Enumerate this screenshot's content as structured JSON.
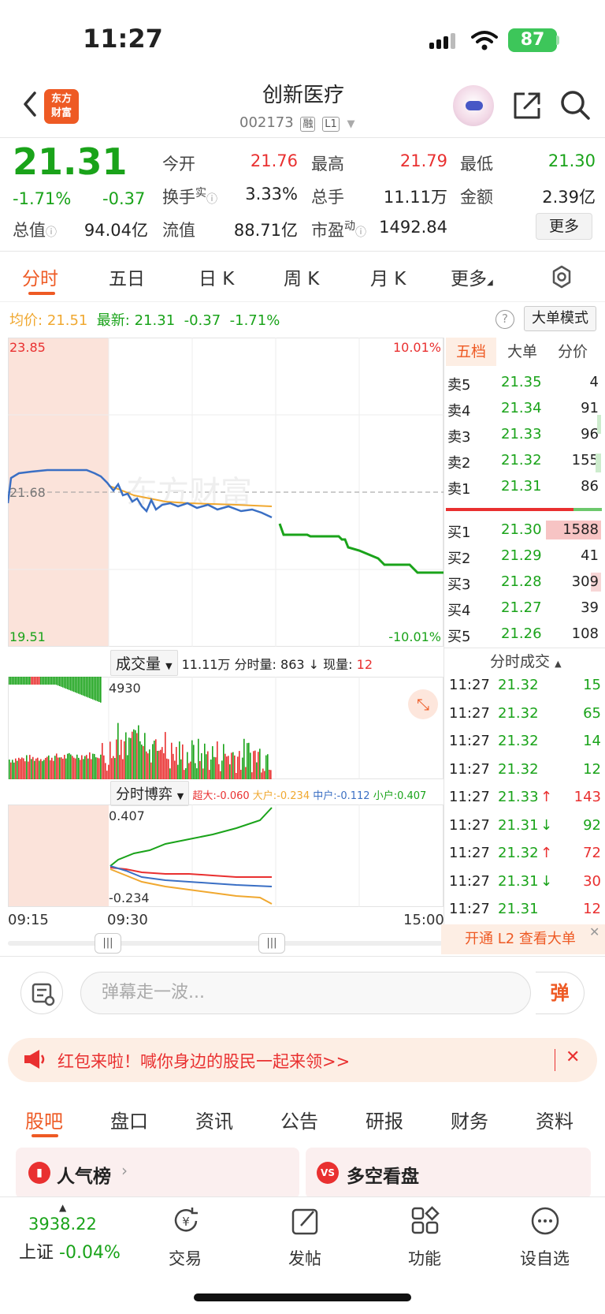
{
  "status": {
    "time": "11:27",
    "battery": "87"
  },
  "header": {
    "name": "创新医疗",
    "code": "002173",
    "tag_margin": "融",
    "tag_level": "L1",
    "logo_line1": "东方",
    "logo_line2": "财富"
  },
  "quote": {
    "price": "21.31",
    "change_pct": "-1.71%",
    "change": "-0.37",
    "open_label": "今开",
    "open": "21.76",
    "high_label": "最高",
    "high": "21.79",
    "low_label": "最低",
    "low": "21.30",
    "turnover_label": "换手",
    "turnover_sup": "实",
    "turnover": "3.33%",
    "volume_label": "总手",
    "volume": "11.11万",
    "amount_label": "金额",
    "amount": "2.39亿",
    "mktcap_label": "总值",
    "mktcap": "94.04亿",
    "float_label": "流值",
    "float_cap": "88.71亿",
    "pe_label": "市盈",
    "pe_sup": "动",
    "pe": "1492.84",
    "more_button": "更多"
  },
  "period_tabs": [
    "分时",
    "五日",
    "日 K",
    "周 K",
    "月 K",
    "更多"
  ],
  "info_line": {
    "avg_label": "均价:",
    "avg": "21.51",
    "latest_label": "最新:",
    "latest": "21.31",
    "chg": "-0.37",
    "pct": "-1.71%"
  },
  "mode_button": "大单模式",
  "chart_labels": {
    "ymax": "23.85",
    "ymin": "19.51",
    "pre_close": "21.68",
    "pct_max": "10.01%",
    "pct_min": "-10.01%",
    "watermark": "东方财富"
  },
  "orderbook": {
    "tabs": [
      "五档",
      "大单",
      "分价"
    ],
    "asks": [
      {
        "label": "卖5",
        "price": "21.35",
        "vol": "4"
      },
      {
        "label": "卖4",
        "price": "21.34",
        "vol": "91"
      },
      {
        "label": "卖3",
        "price": "21.33",
        "vol": "96"
      },
      {
        "label": "卖2",
        "price": "21.32",
        "vol": "155"
      },
      {
        "label": "卖1",
        "price": "21.31",
        "vol": "86"
      }
    ],
    "bids": [
      {
        "label": "买1",
        "price": "21.30",
        "vol": "1588"
      },
      {
        "label": "买2",
        "price": "21.29",
        "vol": "41"
      },
      {
        "label": "买3",
        "price": "21.28",
        "vol": "309"
      },
      {
        "label": "买4",
        "price": "21.27",
        "vol": "39"
      },
      {
        "label": "买5",
        "price": "21.26",
        "vol": "108"
      }
    ]
  },
  "volume_panel": {
    "dropdown": "成交量",
    "total": "11.11万",
    "minute_label": "分时量:",
    "minute_vol": "863",
    "now_label": "现量:",
    "now_vol": "12",
    "peak": "4930"
  },
  "game_panel": {
    "dropdown": "分时博弈",
    "super_label": "超大:",
    "super": "-0.060",
    "big_label": "大户:",
    "big": "-0.234",
    "mid_label": "中户:",
    "mid": "-0.112",
    "small_label": "小户:",
    "small": "0.407",
    "ymax": "0.407",
    "ymin": "-0.234"
  },
  "time_axis": [
    "09:15",
    "09:30",
    "15:00"
  ],
  "trades": {
    "title": "分时成交",
    "rows": [
      {
        "time": "11:27",
        "price": "21.32",
        "dir": "",
        "vol": "15",
        "color": "green"
      },
      {
        "time": "11:27",
        "price": "21.32",
        "dir": "",
        "vol": "65",
        "color": "green"
      },
      {
        "time": "11:27",
        "price": "21.32",
        "dir": "",
        "vol": "14",
        "color": "green"
      },
      {
        "time": "11:27",
        "price": "21.32",
        "dir": "",
        "vol": "12",
        "color": "green"
      },
      {
        "time": "11:27",
        "price": "21.33",
        "dir": "↑",
        "vol": "143",
        "color": "red"
      },
      {
        "time": "11:27",
        "price": "21.31",
        "dir": "↓",
        "vol": "92",
        "color": "green"
      },
      {
        "time": "11:27",
        "price": "21.32",
        "dir": "↑",
        "vol": "72",
        "color": "red"
      },
      {
        "time": "11:27",
        "price": "21.31",
        "dir": "↓",
        "vol": "30",
        "color": "red"
      },
      {
        "time": "11:27",
        "price": "21.31",
        "dir": "",
        "vol": "12",
        "color": "red"
      }
    ],
    "l2_banner": "开通 L2 查看大单"
  },
  "comment": {
    "placeholder": "弹幕走一波...",
    "danmu_button": "弹"
  },
  "promo": {
    "text": "红包来啦！喊你身边的股民一起来领>>"
  },
  "bottom_tabs": [
    "股吧",
    "盘口",
    "资讯",
    "公告",
    "研报",
    "财务",
    "资料"
  ],
  "cards": {
    "left": "人气榜",
    "right": "多空看盘"
  },
  "nav": {
    "index_value": "3938.22",
    "index_name": "上证",
    "index_change": "-0.04%",
    "trade": "交易",
    "post": "发帖",
    "features": "功能",
    "watchlist": "设自选"
  },
  "colors": {
    "up": "#e93030",
    "down": "#1aa31a",
    "accent": "#ee5a24",
    "avg_line": "#f0a830",
    "price_line": "#3a6fc4"
  }
}
